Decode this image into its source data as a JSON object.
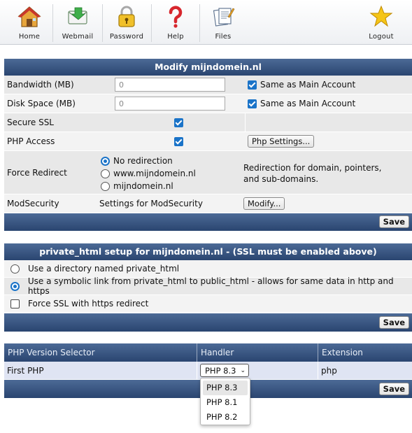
{
  "nav": {
    "items": [
      {
        "label": "Home",
        "icon": "house-icon"
      },
      {
        "label": "Webmail",
        "icon": "envelope-icon"
      },
      {
        "label": "Password",
        "icon": "padlock-icon"
      },
      {
        "label": "Help",
        "icon": "question-mark-icon"
      },
      {
        "label": "Files",
        "icon": "documents-icon"
      },
      {
        "label": "Logout",
        "icon": "star-icon"
      }
    ]
  },
  "modify": {
    "title": "Modify mijndomein.nl",
    "bandwidth": {
      "label": "Bandwidth (MB)",
      "value": "0",
      "same_label": "Same as Main Account",
      "same_checked": true
    },
    "diskspace": {
      "label": "Disk Space (MB)",
      "value": "0",
      "same_label": "Same as Main Account",
      "same_checked": true
    },
    "secure_ssl": {
      "label": "Secure SSL",
      "checked": true
    },
    "php_access": {
      "label": "PHP Access",
      "checked": true,
      "button": "Php Settings..."
    },
    "force_redirect": {
      "label": "Force Redirect",
      "options": [
        "No redirection",
        "www.mijndomein.nl",
        "mijndomein.nl"
      ],
      "selected": "No redirection",
      "note_line1": "Redirection for domain, pointers,",
      "note_line2": "and sub-domains."
    },
    "modsecurity": {
      "label": "ModSecurity",
      "text": "Settings for ModSecurity",
      "button": "Modify..."
    },
    "save": "Save"
  },
  "private_html": {
    "title": "private_html setup for mijndomein.nl - (SSL must be enabled above)",
    "opt_directory": "Use a directory named private_html",
    "opt_symlink": "Use a symbolic link from private_html to public_html - allows for same data in http and https",
    "force_ssl": "Force SSL with https redirect",
    "selected": "symlink",
    "save": "Save"
  },
  "php_selector": {
    "headers": [
      "PHP Version Selector",
      "Handler",
      "Extension"
    ],
    "row": {
      "name": "First PHP",
      "version": "PHP 8.3",
      "extension": "php"
    },
    "dropdown_options": [
      "PHP 8.3",
      "PHP 8.1",
      "PHP 8.2"
    ],
    "save": "Save"
  },
  "colors": {
    "header_bar": "#3a5682",
    "checkbox": "#1a73c8",
    "row_light": "#f3f3f3",
    "row_dark": "#e8e8e8"
  }
}
